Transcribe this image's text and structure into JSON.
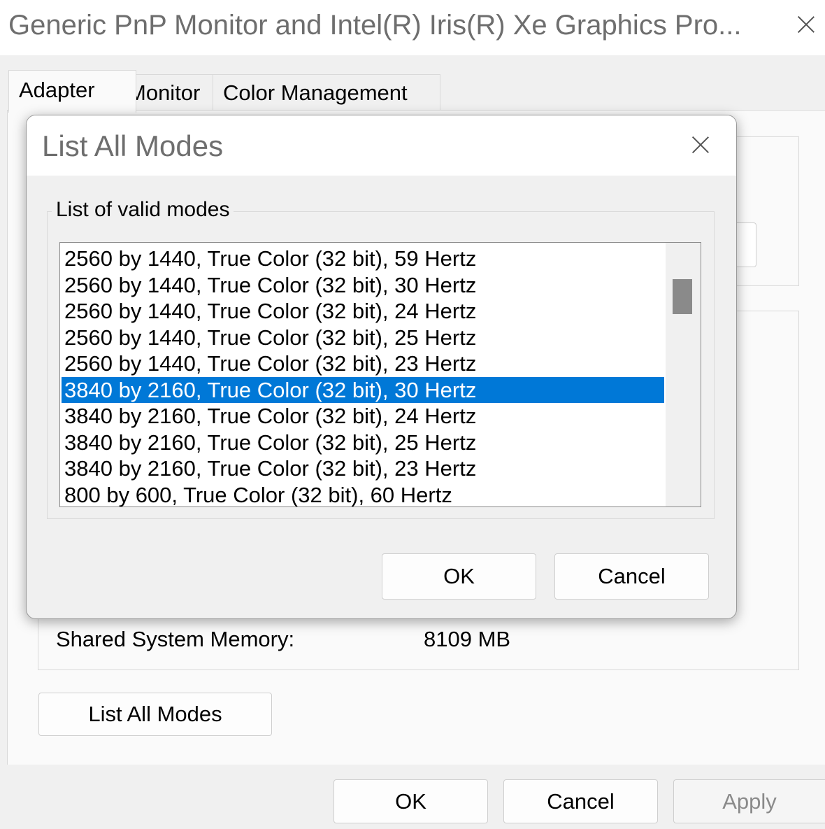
{
  "window": {
    "title": "Generic PnP Monitor and Intel(R) Iris(R) Xe Graphics Pro..."
  },
  "tabs": [
    {
      "label": "Adapter",
      "active": true
    },
    {
      "label": "Monitor",
      "active": false
    },
    {
      "label": "Color Management",
      "active": false
    }
  ],
  "adapter": {
    "shared_memory_label": "Shared System Memory:",
    "shared_memory_value": "8109 MB",
    "list_all_modes_label": "List All Modes"
  },
  "footer": {
    "ok_label": "OK",
    "cancel_label": "Cancel",
    "apply_label": "Apply"
  },
  "dialog": {
    "title": "List All Modes",
    "group_label": "List of valid modes",
    "modes": [
      "2560 by 1440, True Color (32 bit), 59 Hertz",
      "2560 by 1440, True Color (32 bit), 30 Hertz",
      "2560 by 1440, True Color (32 bit), 24 Hertz",
      "2560 by 1440, True Color (32 bit), 25 Hertz",
      "2560 by 1440, True Color (32 bit), 23 Hertz",
      "3840 by 2160, True Color (32 bit), 30 Hertz",
      "3840 by 2160, True Color (32 bit), 24 Hertz",
      "3840 by 2160, True Color (32 bit), 25 Hertz",
      "3840 by 2160, True Color (32 bit), 23 Hertz",
      "800 by 600, True Color (32 bit), 60 Hertz"
    ],
    "selected_index": 5,
    "scroll_position": 0.15,
    "ok_label": "OK",
    "cancel_label": "Cancel"
  },
  "colors": {
    "selection": "#0078d7",
    "window_bg": "#f0f0f0",
    "title_text": "#6e6e6e"
  }
}
